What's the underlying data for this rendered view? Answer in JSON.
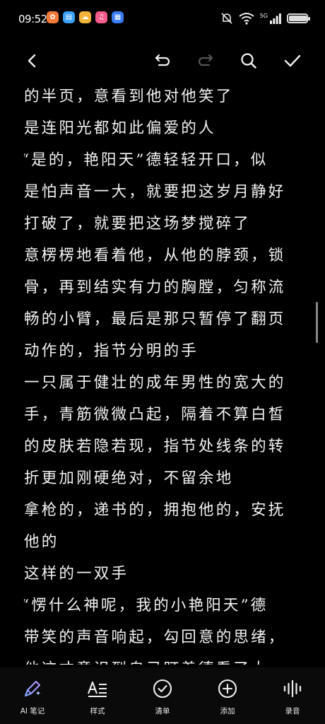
{
  "status": {
    "time": "09:52",
    "network": "5G",
    "app_icons": [
      {
        "name": "orange-app-icon",
        "color": "#f47a3a",
        "glyph": "✿"
      },
      {
        "name": "books-app-icon",
        "color": "#3aa0f4",
        "glyph": "▤"
      },
      {
        "name": "weather-app-icon",
        "color": "#f4b43a",
        "glyph": "☁"
      },
      {
        "name": "music-app-icon",
        "color": "#f45a8a",
        "glyph": "♫"
      },
      {
        "name": "calendar-app-icon",
        "color": "#3a7af4",
        "glyph": "▦"
      }
    ],
    "battery_level": 0.95
  },
  "editor": {
    "lines": [
      "的半页，意看到他对他笑了",
      "是连阳光都如此偏爱的人",
      "“是的，艳阳天”德轻轻开口，似",
      "是怕声音一大，就要把这岁月静好",
      "打破了，就要把这场梦搅碎了",
      "意楞楞地看着他，从他的脖颈，锁",
      "骨，再到结实有力的胸膛，匀称流",
      "畅的小臂，最后是那只暂停了翻页",
      "动作的，指节分明的手",
      "一只属于健壮的成年男性的宽大的",
      "手，青筋微微凸起，隔着不算白皙",
      "的皮肤若隐若现，指节处线条的转",
      "折更加刚硬绝对，不留余地",
      "拿枪的，递书的，拥抱他的，安抚",
      "他的",
      "这样的一双手",
      "“愣什么神呢，我的小艳阳天”德",
      "带笑的声音响起，勾回意的思绪，",
      "他这才意识到自己盯着德看了太"
    ]
  },
  "bottom_nav": {
    "items": [
      {
        "label": "AI 笔记",
        "name": "ai-notes"
      },
      {
        "label": "样式",
        "name": "style"
      },
      {
        "label": "清单",
        "name": "checklist"
      },
      {
        "label": "添加",
        "name": "add"
      },
      {
        "label": "录音",
        "name": "record"
      }
    ]
  }
}
